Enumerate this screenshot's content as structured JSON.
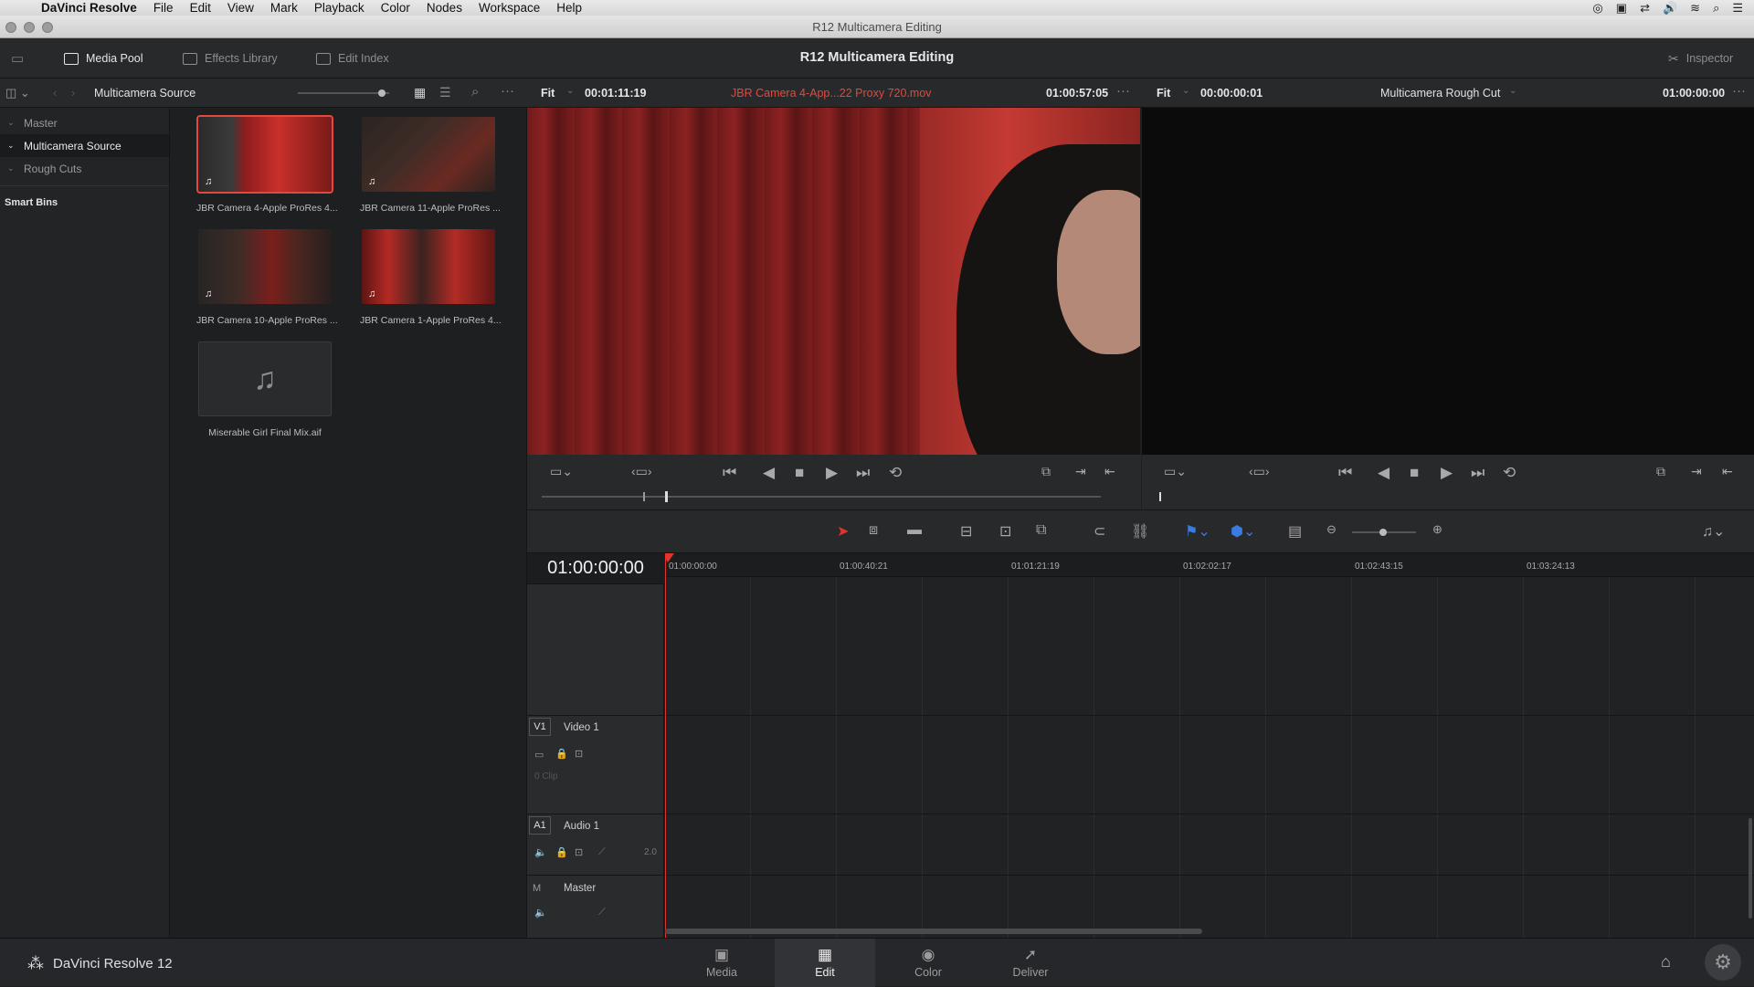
{
  "menubar": {
    "app": "DaVinci Resolve",
    "items": [
      "File",
      "Edit",
      "View",
      "Mark",
      "Playback",
      "Color",
      "Nodes",
      "Workspace",
      "Help"
    ]
  },
  "window": {
    "title": "R12 Multicamera Editing"
  },
  "toolbar": {
    "media_pool": "Media Pool",
    "effects_library": "Effects Library",
    "edit_index": "Edit Index",
    "project_title": "R12 Multicamera Editing",
    "inspector": "Inspector"
  },
  "source_viewer": {
    "bin_name": "Multicamera Source",
    "zoom": "Fit",
    "duration": "00:01:11:19",
    "clip_name": "JBR Camera 4-App...22 Proxy 720.mov",
    "timecode": "01:00:57:05",
    "scrub_position": 0.22
  },
  "timeline_viewer": {
    "zoom": "Fit",
    "duration": "00:00:00:01",
    "timeline_name": "Multicamera Rough Cut",
    "timecode": "01:00:00:00"
  },
  "bins": {
    "items": [
      {
        "label": "Master",
        "selected": false
      },
      {
        "label": "Multicamera Source",
        "selected": true
      },
      {
        "label": "Rough Cuts",
        "selected": false
      }
    ],
    "smart_bins": "Smart Bins"
  },
  "clips": [
    {
      "name": "JBR Camera 4-Apple ProRes 4...",
      "selected": true
    },
    {
      "name": "JBR Camera 11-Apple ProRes ...",
      "selected": false
    },
    {
      "name": "JBR Camera 10-Apple ProRes ...",
      "selected": false
    },
    {
      "name": "JBR Camera 1-Apple ProRes 4...",
      "selected": false
    },
    {
      "name": "Miserable Girl Final Mix.aif",
      "selected": false
    }
  ],
  "timeline": {
    "current_timecode": "01:00:00:00",
    "ruler": [
      "01:00:00:00",
      "01:00:40:21",
      "01:01:21:19",
      "01:02:02:17",
      "01:02:43:15",
      "01:03:24:13"
    ],
    "tracks": {
      "v1_tag": "V1",
      "v1_name": "Video 1",
      "v1_clips": "0 Clip",
      "a1_tag": "A1",
      "a1_name": "Audio 1",
      "a1_channels": "2.0",
      "m_tag": "M",
      "m_name": "Master"
    }
  },
  "pagebar": {
    "brand": "DaVinci Resolve 12",
    "tabs": [
      "Media",
      "Edit",
      "Color",
      "Deliver"
    ],
    "active": "Edit"
  },
  "colors": {
    "accent_red": "#e04a3e",
    "playhead": "#e0342c"
  }
}
